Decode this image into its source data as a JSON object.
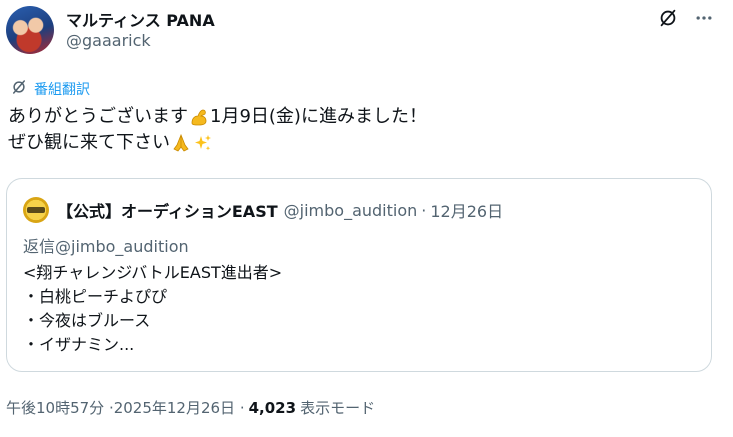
{
  "author": {
    "display_name": "マルティンス PANA",
    "handle": "@gaaarick"
  },
  "icons": {
    "grok": "grok-icon",
    "more": "more-icon",
    "translate": "translate-icon"
  },
  "translate": {
    "label": "番組翻訳"
  },
  "tweet": {
    "line1_a": "ありがとうございます",
    "line1_b": "1月9日(金)に進みました！",
    "line2": "ぜひ観に来て下さい",
    "emojis": [
      "flexed-biceps",
      "folded-hands",
      "sparkles"
    ]
  },
  "quote": {
    "name": "【公式】オーディションEAST",
    "handle": "@jimbo_audition",
    "separator": "·",
    "date": "12月26日",
    "reply_to": "返信@jimbo_audition",
    "lines": [
      "<翔チャレンジバトルEAST進出者>",
      "・白桃ピーチよぴぴ",
      "・今夜はブルース",
      "・イザナミン..."
    ]
  },
  "footer": {
    "timestamp": "午後10時57分 ·2025年12月26日 · ",
    "views_count": "4,023",
    "views_label": "表示モード"
  },
  "colors": {
    "text": "#0f1419",
    "secondary": "#536471",
    "accent": "#1d9bf0",
    "border": "#cfd9de"
  }
}
